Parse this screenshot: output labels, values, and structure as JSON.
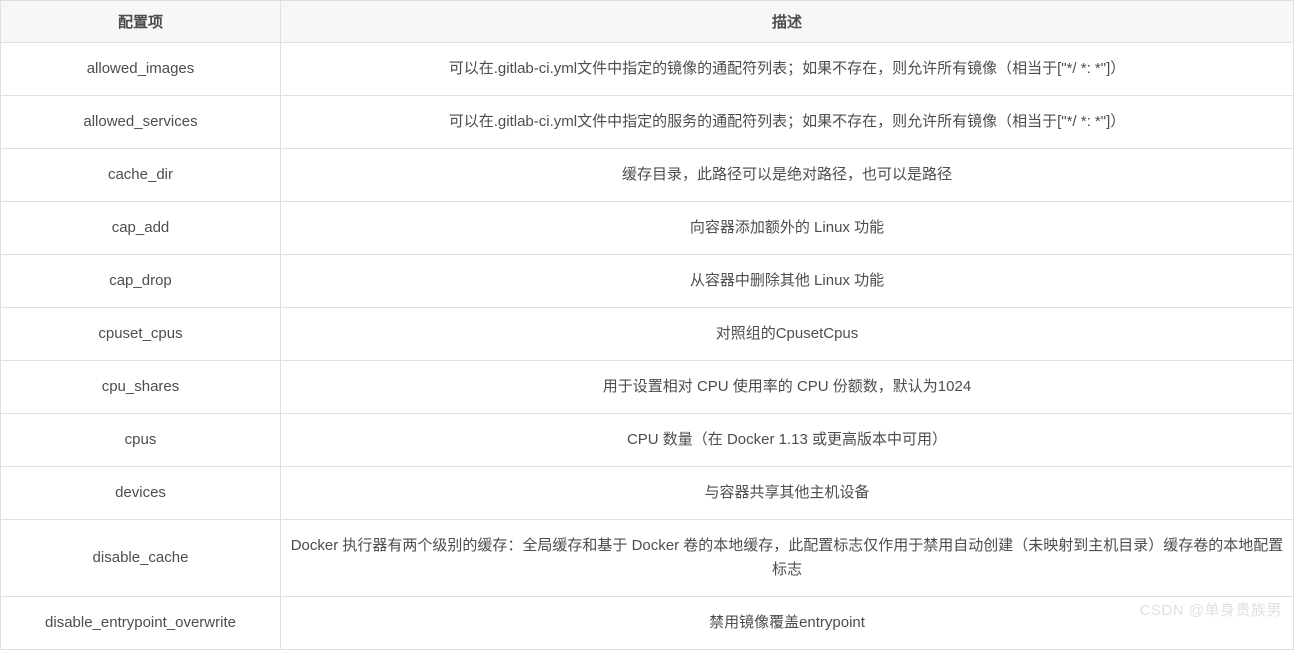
{
  "table": {
    "headers": {
      "config": "配置项",
      "desc": "描述"
    },
    "rows": [
      {
        "config": "allowed_images",
        "desc": "可以在.gitlab-ci.yml文件中指定的镜像的通配符列表；如果不存在，则允许所有镜像（相当于[\"*/ *: *\"]）"
      },
      {
        "config": "allowed_services",
        "desc": "可以在.gitlab-ci.yml文件中指定的服务的通配符列表；如果不存在，则允许所有镜像（相当于[\"*/ *: *\"]）"
      },
      {
        "config": "cache_dir",
        "desc": "缓存目录，此路径可以是绝对路径，也可以是路径"
      },
      {
        "config": "cap_add",
        "desc": "向容器添加额外的 Linux 功能"
      },
      {
        "config": "cap_drop",
        "desc": "从容器中删除其他 Linux 功能"
      },
      {
        "config": "cpuset_cpus",
        "desc": "对照组的CpusetCpus"
      },
      {
        "config": "cpu_shares",
        "desc": "用于设置相对 CPU 使用率的 CPU 份额数，默认为1024"
      },
      {
        "config": "cpus",
        "desc": "CPU 数量（在 Docker 1.13 或更高版本中可用）"
      },
      {
        "config": "devices",
        "desc": "与容器共享其他主机设备"
      },
      {
        "config": "disable_cache",
        "desc": "Docker 执行器有两个级别的缓存：全局缓存和基于 Docker 卷的本地缓存，此配置标志仅作用于禁用自动创建（未映射到主机目录）缓存卷的本地配置标志"
      },
      {
        "config": "disable_entrypoint_overwrite",
        "desc": "禁用镜像覆盖entrypoint"
      }
    ]
  },
  "watermark": "CSDN @单身贵族男"
}
